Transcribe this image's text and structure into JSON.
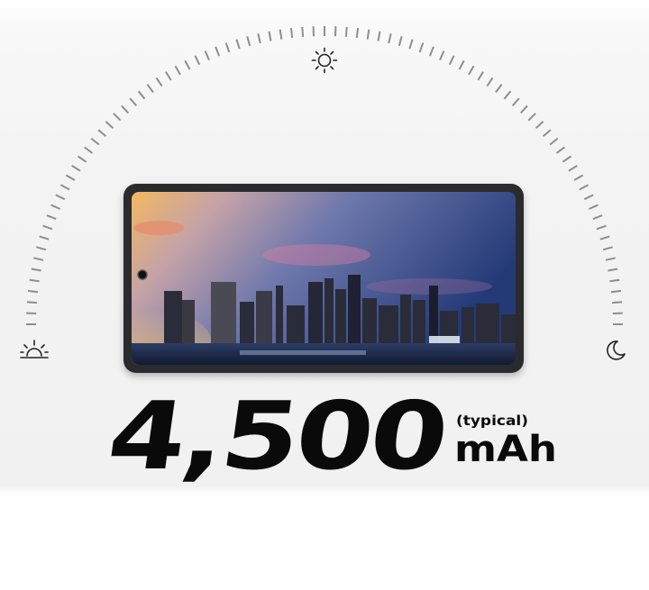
{
  "battery": {
    "capacity": "4,500",
    "qualifier": "(typical)",
    "unit": "mAh"
  },
  "icons": {
    "left": "sunrise-icon",
    "top": "sun-icon",
    "right": "moon-icon"
  },
  "colors": {
    "text": "#0a0a0a",
    "arc_ticks": "#8e8e8e",
    "phone_frame": "#2b2b2e"
  }
}
